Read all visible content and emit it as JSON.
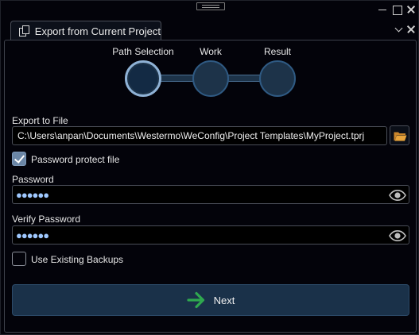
{
  "window": {
    "controls": [
      "minimize",
      "maximize",
      "close"
    ]
  },
  "tab": {
    "title": "Export from Current Project",
    "icon": "copy-pages-icon"
  },
  "stepper": {
    "steps": [
      {
        "label": "Path Selection",
        "active": true
      },
      {
        "label": "Work",
        "active": false
      },
      {
        "label": "Result",
        "active": false
      }
    ]
  },
  "export": {
    "label": "Export to File",
    "path": "C:\\Users\\anpan\\Documents\\Westermo\\WeConfig\\Project Templates\\MyProject.tprj"
  },
  "password_protect": {
    "label": "Password protect file",
    "checked": true
  },
  "password": {
    "label": "Password",
    "masked_value": "●●●●●●"
  },
  "verify_password": {
    "label": "Verify Password",
    "masked_value": "●●●●●●"
  },
  "use_backups": {
    "label": "Use Existing Backups",
    "checked": false
  },
  "next_button": {
    "label": "Next",
    "icon": "arrow-right-icon"
  },
  "colors": {
    "background": "#03030a",
    "accent": "#1a3149",
    "arrow": "#2fa84f",
    "folder": "#e8a43c"
  }
}
